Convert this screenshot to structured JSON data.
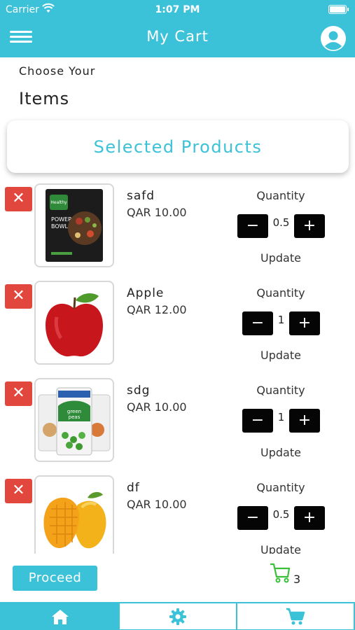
{
  "status": {
    "carrier": "Carrier",
    "time": "1:07 PM"
  },
  "nav": {
    "title": "My Cart",
    "menu_icon": "hamburger-menu-icon",
    "profile_icon": "user-avatar-icon"
  },
  "header": {
    "choose_label": "Choose Your",
    "items_label": "Items"
  },
  "section": {
    "title": "Selected Products"
  },
  "cart_items": [
    {
      "name": "safd",
      "price": "QAR 10.00",
      "quantity_label": "Quantity",
      "quantity": "0.5",
      "update_label": "Update",
      "image": "power-bowls-package"
    },
    {
      "name": "Apple",
      "price": "QAR 12.00",
      "quantity_label": "Quantity",
      "quantity": "1",
      "update_label": "Update",
      "image": "red-apple"
    },
    {
      "name": "sdg",
      "price": "QAR 10.00",
      "quantity_label": "Quantity",
      "quantity": "1",
      "update_label": "Update",
      "image": "green-peas-bags"
    },
    {
      "name": "df",
      "price": "QAR 10.00",
      "quantity_label": "Quantity",
      "quantity": "0.5",
      "update_label": "Update",
      "image": "mangoes"
    }
  ],
  "controls": {
    "remove_symbol": "✕",
    "minus_symbol": "−",
    "plus_symbol": "+"
  },
  "footer": {
    "proceed_label": "Proceed",
    "cart_count": "3"
  },
  "tabs": [
    {
      "icon": "home-icon",
      "active": true
    },
    {
      "icon": "gear-icon",
      "active": false
    },
    {
      "icon": "cart-icon",
      "active": false
    }
  ],
  "colors": {
    "accent": "#3cc2d8",
    "remove": "#e2473d",
    "stepper": "#050505",
    "cart_green": "#3bbf3b"
  }
}
